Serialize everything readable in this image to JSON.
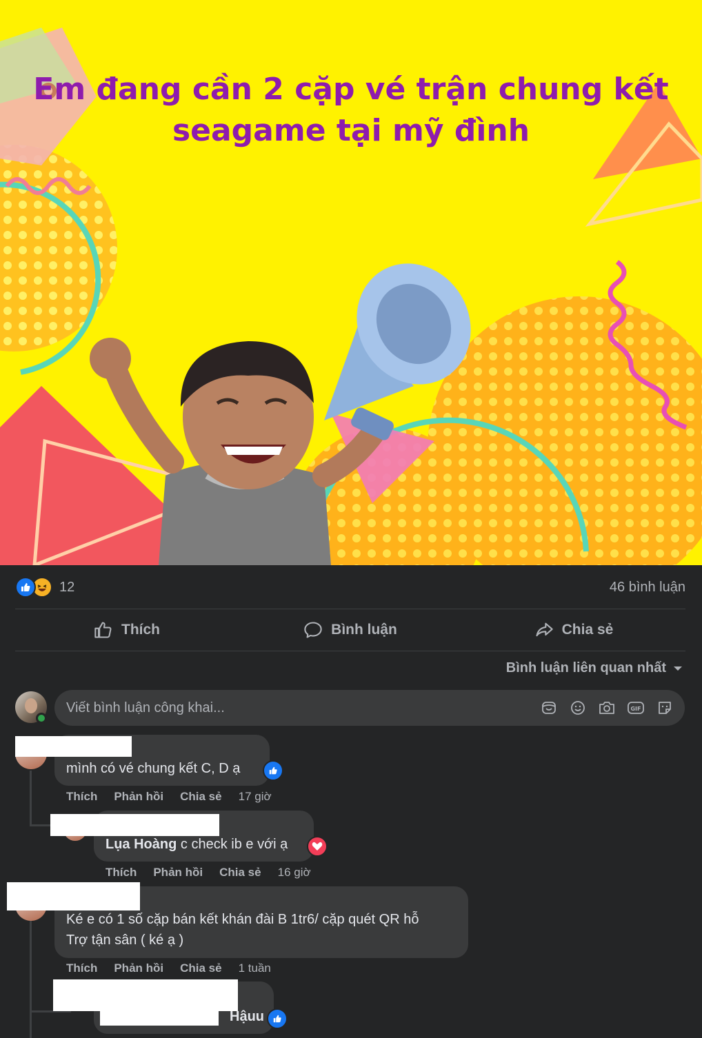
{
  "post": {
    "image_text_line1": "Em đang cần 2 cặp vé trận chung kết",
    "image_text_line2": "seagame tại mỹ đình",
    "text_color": "#8e1cad",
    "background_color": "#fff200"
  },
  "stats": {
    "reaction_icons": [
      "like-icon",
      "haha-icon"
    ],
    "reaction_count": "12",
    "comment_count": "46 bình luận"
  },
  "actions": {
    "like": "Thích",
    "comment": "Bình luận",
    "share": "Chia sẻ"
  },
  "sort": {
    "label": "Bình luận liên quan nhất"
  },
  "composer": {
    "placeholder": "Viết bình luận công khai...",
    "icons": [
      "sticker-icon",
      "emoji-icon",
      "camera-icon",
      "gif-icon",
      "avatar-sticker-icon"
    ]
  },
  "comments": [
    {
      "text": "mình có vé chung kết C, D ạ",
      "reaction": "like",
      "actions": {
        "like": "Thích",
        "reply": "Phản hồi",
        "share": "Chia sẻ"
      },
      "time": "17 giờ",
      "replies": [
        {
          "mention": "Lụa Hoàng",
          "text": " c check ib e với ạ",
          "reaction": "love",
          "actions": {
            "like": "Thích",
            "reply": "Phản hồi",
            "share": "Chia sẻ"
          },
          "time": "16 giờ"
        }
      ]
    },
    {
      "text_line1": "Ké e có 1 số cặp bán kết khán đài B 1tr6/ cặp quét QR hỗ",
      "text_line2": "Trợ tận sân ( ké ạ )",
      "actions": {
        "like": "Thích",
        "reply": "Phản hồi",
        "share": "Chia sẻ"
      },
      "time": "1 tuần",
      "replies": [
        {
          "mention_visible": "Hậuu",
          "reaction": "like"
        }
      ]
    }
  ],
  "colors": {
    "panel": "#242526",
    "bubble": "#3a3b3c",
    "secondary_text": "#b0b3b8",
    "like_blue": "#1877f2",
    "love_red": "#f33e58",
    "online_green": "#31a24c"
  }
}
